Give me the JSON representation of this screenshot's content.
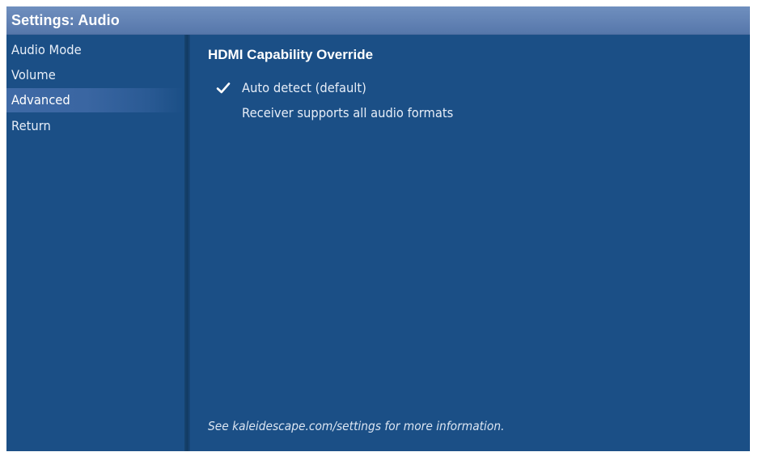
{
  "window": {
    "title": "Settings: Audio"
  },
  "colors": {
    "background": "#1b4f86",
    "title_bar": "#6282b4",
    "selected_item": "#3f6aa6",
    "text": "#e7eef8"
  },
  "sidebar": {
    "items": [
      {
        "label": "Audio Mode",
        "selected": false
      },
      {
        "label": "Volume",
        "selected": false
      },
      {
        "label": "Advanced",
        "selected": true
      },
      {
        "label": "Return",
        "selected": false
      }
    ]
  },
  "main": {
    "heading": "HDMI Capability Override",
    "options": [
      {
        "label": "Auto detect (default)",
        "checked": true,
        "icon": "checkmark-icon"
      },
      {
        "label": "Receiver supports all audio formats",
        "checked": false
      }
    ],
    "footer": "See kaleidescape.com/settings for more information."
  }
}
